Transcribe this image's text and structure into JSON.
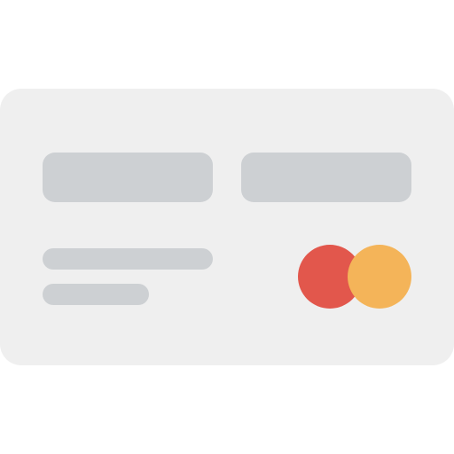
{
  "icon": {
    "name": "credit-card-icon",
    "card_color": "#efefef",
    "placeholder_color": "#cdd0d3",
    "logo": {
      "name": "card-brand-logo",
      "left_circle_color": "#e2574c",
      "right_circle_color": "#f4b459"
    }
  }
}
